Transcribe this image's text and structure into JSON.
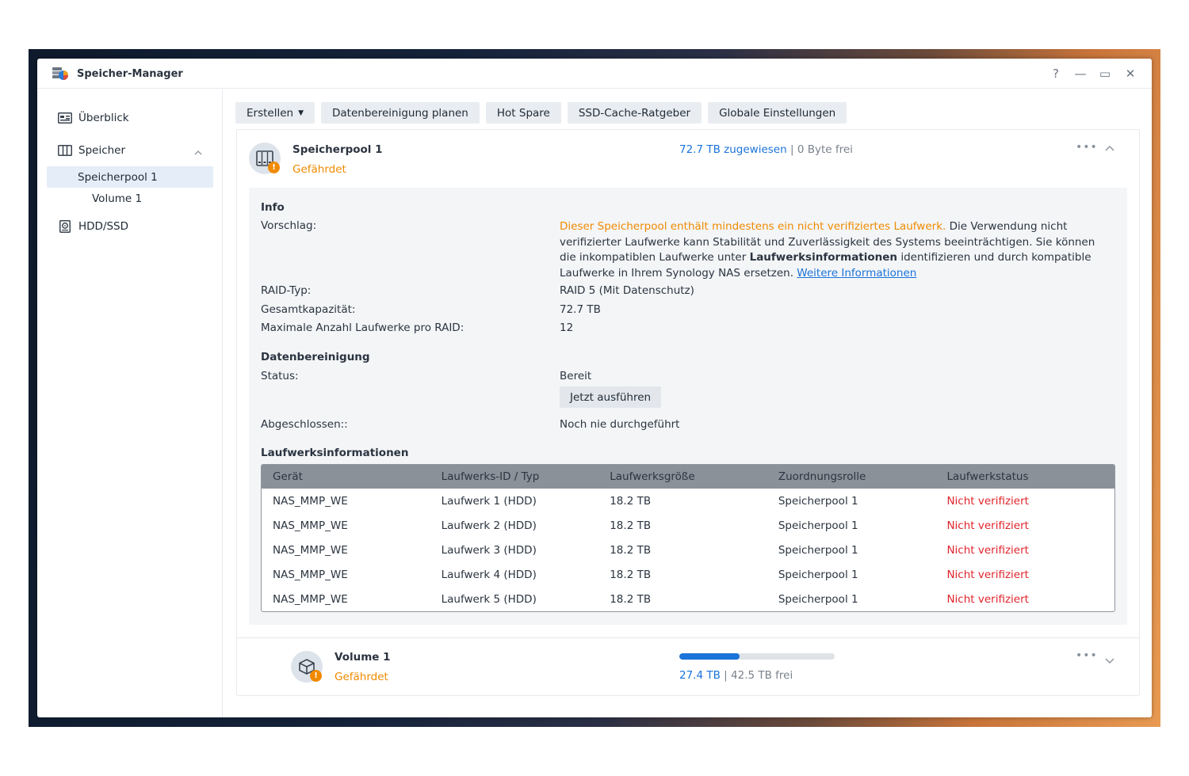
{
  "window": {
    "title": "Speicher-Manager",
    "help_icon": "?",
    "minimize_icon": "—",
    "maximize_icon": "▭",
    "close_icon": "✕"
  },
  "sidebar": {
    "items": [
      {
        "label": "Überblick",
        "icon": "overview-icon"
      },
      {
        "label": "Speicher",
        "icon": "storage-icon"
      },
      {
        "label": "Speicherpool 1"
      },
      {
        "label": "Volume 1"
      },
      {
        "label": "HDD/SSD",
        "icon": "hdd-icon"
      }
    ]
  },
  "toolbar": {
    "create": "Erstellen",
    "scrub_schedule": "Datenbereinigung planen",
    "hot_spare": "Hot Spare",
    "ssd_cache": "SSD-Cache-Ratgeber",
    "global_settings": "Globale Einstellungen"
  },
  "pool": {
    "name": "Speicherpool 1",
    "status": "Gefährdet",
    "allocated": "72.7 TB zugewiesen",
    "separator": "|",
    "free": "0 Byte frei",
    "more": "•••"
  },
  "info": {
    "title": "Info",
    "suggestion_label": "Vorschlag:",
    "suggestion_warning": "Dieser Speicherpool enthält mindestens ein nicht verifiziertes Laufwerk.",
    "suggestion_text_1": " Die Verwendung nicht verifizierter Laufwerke kann Stabilität und Zuverlässigkeit des Systems beeinträchtigen. Sie können die inkompatiblen Laufwerke unter ",
    "suggestion_bold": "Laufwerksinformationen",
    "suggestion_text_2": " identifizieren und durch kompatible Laufwerke in Ihrem Synology NAS ersetzen. ",
    "suggestion_link": "Weitere Informationen",
    "raid_label": "RAID-Typ:",
    "raid_value": "RAID 5 (Mit Datenschutz)",
    "capacity_label": "Gesamtkapazität:",
    "capacity_value": "72.7 TB",
    "max_drives_label": "Maximale Anzahl Laufwerke pro RAID:",
    "max_drives_value": "12"
  },
  "scrubbing": {
    "title": "Datenbereinigung",
    "status_label": "Status:",
    "status_value": "Bereit",
    "run_button": "Jetzt ausführen",
    "completed_label": "Abgeschlossen::",
    "completed_value": "Noch nie durchgeführt"
  },
  "drives": {
    "title": "Laufwerksinformationen",
    "headers": [
      "Gerät",
      "Laufwerks-ID / Typ",
      "Laufwerksgröße",
      "Zuordnungsrolle",
      "Laufwerkstatus"
    ],
    "rows": [
      [
        "NAS_MMP_WE",
        "Laufwerk 1 (HDD)",
        "18.2 TB",
        "Speicherpool 1",
        "Nicht verifiziert"
      ],
      [
        "NAS_MMP_WE",
        "Laufwerk 2 (HDD)",
        "18.2 TB",
        "Speicherpool 1",
        "Nicht verifiziert"
      ],
      [
        "NAS_MMP_WE",
        "Laufwerk 3 (HDD)",
        "18.2 TB",
        "Speicherpool 1",
        "Nicht verifiziert"
      ],
      [
        "NAS_MMP_WE",
        "Laufwerk 4 (HDD)",
        "18.2 TB",
        "Speicherpool 1",
        "Nicht verifiziert"
      ],
      [
        "NAS_MMP_WE",
        "Laufwerk 5 (HDD)",
        "18.2 TB",
        "Speicherpool 1",
        "Nicht verifiziert"
      ]
    ]
  },
  "volume": {
    "name": "Volume 1",
    "status": "Gefährdet",
    "used": "27.4 TB",
    "separator": "|",
    "free": "42.5 TB frei",
    "usage_fraction": 0.39,
    "more": "•••"
  },
  "colors": {
    "accent": "#1a73d9",
    "warning": "#f08a00",
    "error": "#e0242c"
  }
}
